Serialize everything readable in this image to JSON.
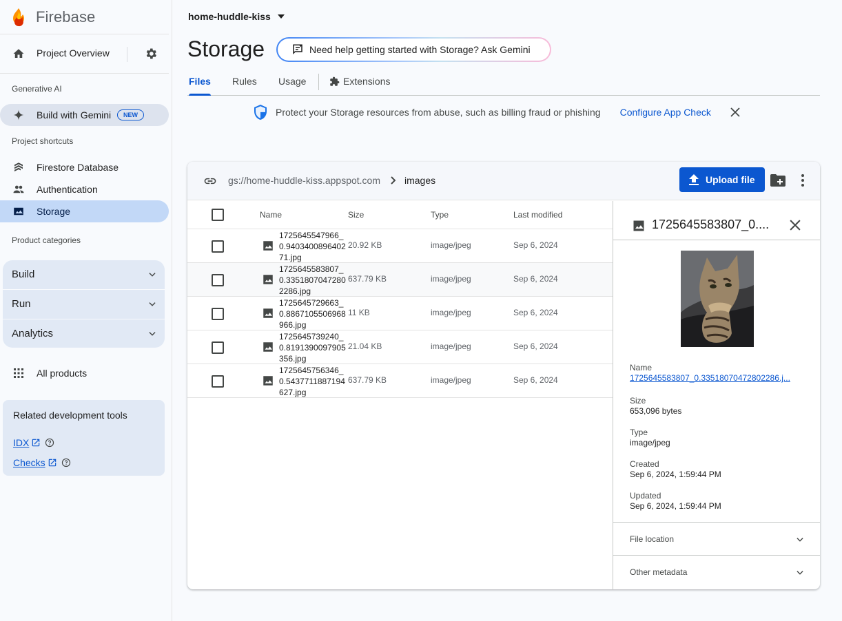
{
  "brand": {
    "name": "Firebase"
  },
  "sidebar": {
    "project_overview": "Project Overview",
    "section_generative_ai": "Generative AI",
    "build_with_gemini": "Build with Gemini",
    "new_badge": "NEW",
    "section_shortcuts": "Project shortcuts",
    "shortcuts": [
      "Firestore Database",
      "Authentication",
      "Storage"
    ],
    "section_categories": "Product categories",
    "categories": [
      "Build",
      "Run",
      "Analytics"
    ],
    "all_products": "All products",
    "devtools_title": "Related development tools",
    "devtools_links": [
      "IDX",
      "Checks"
    ]
  },
  "header": {
    "project": "home-huddle-kiss",
    "title": "Storage",
    "gemini_prompt": "Need help getting started with Storage? Ask Gemini"
  },
  "tabs": [
    "Files",
    "Rules",
    "Usage",
    "Extensions"
  ],
  "banner": {
    "message": "Protect your Storage resources from abuse, such as billing fraud or phishing",
    "link": "Configure App Check"
  },
  "browser": {
    "bucket": "gs://home-huddle-kiss.appspot.com",
    "folder": "images",
    "upload_label": "Upload file",
    "columns": [
      "Name",
      "Size",
      "Type",
      "Last modified"
    ],
    "rows": [
      {
        "name": "1725645547966_0.940340089640271.jpg",
        "size": "20.92 KB",
        "type": "image/jpeg",
        "modified": "Sep 6, 2024"
      },
      {
        "name": "1725645583807_0.33518070472802286.jpg",
        "size": "637.79 KB",
        "type": "image/jpeg",
        "modified": "Sep 6, 2024"
      },
      {
        "name": "1725645729663_0.8867105506968966.jpg",
        "size": "11 KB",
        "type": "image/jpeg",
        "modified": "Sep 6, 2024"
      },
      {
        "name": "1725645739240_0.8191390097905356.jpg",
        "size": "21.04 KB",
        "type": "image/jpeg",
        "modified": "Sep 6, 2024"
      },
      {
        "name": "1725645756346_0.5437711887194627.jpg",
        "size": "637.79 KB",
        "type": "image/jpeg",
        "modified": "Sep 6, 2024"
      }
    ]
  },
  "detail": {
    "title": "1725645583807_0....",
    "name_label": "Name",
    "name_value": "1725645583807_0.33518070472802286.j...",
    "size_label": "Size",
    "size_value": "653,096 bytes",
    "type_label": "Type",
    "type_value": "image/jpeg",
    "created_label": "Created",
    "created_value": "Sep 6, 2024, 1:59:44 PM",
    "updated_label": "Updated",
    "updated_value": "Sep 6, 2024, 1:59:44 PM",
    "file_location": "File location",
    "other_metadata": "Other metadata"
  },
  "colors": {
    "accent": "#0b57d0",
    "selected_nav": "#c2d8f7",
    "sidebar_bg": "#f8fafd"
  }
}
